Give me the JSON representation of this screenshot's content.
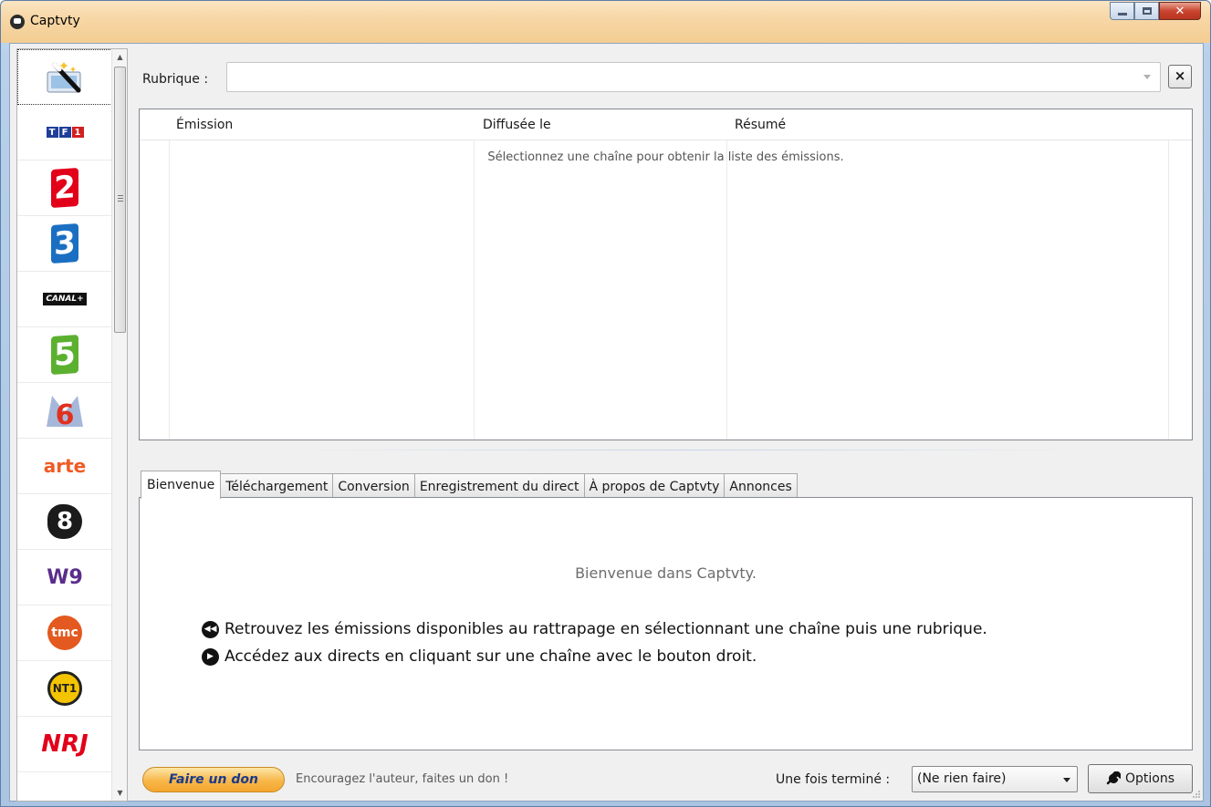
{
  "window": {
    "title": "Captvty",
    "controls": [
      "minimize",
      "maximize",
      "close"
    ]
  },
  "sidebar": {
    "channels": [
      {
        "name": "magic-wand",
        "label": ""
      },
      {
        "name": "tf1",
        "label": "TF1"
      },
      {
        "name": "france2",
        "label": "2"
      },
      {
        "name": "france3",
        "label": "3"
      },
      {
        "name": "canalplus",
        "label": "CANAL+"
      },
      {
        "name": "france5",
        "label": "5"
      },
      {
        "name": "m6",
        "label": "6"
      },
      {
        "name": "arte",
        "label": "arte"
      },
      {
        "name": "c8",
        "label": "8"
      },
      {
        "name": "w9",
        "label": "W9"
      },
      {
        "name": "tmc",
        "label": "tmc"
      },
      {
        "name": "nt1",
        "label": "NT1"
      },
      {
        "name": "nrj12",
        "label": "NRJ"
      }
    ]
  },
  "rubrique": {
    "label": "Rubrique :",
    "value": "",
    "clear_label": "×"
  },
  "grid": {
    "columns": [
      "Émission",
      "Diffusée le",
      "Résumé"
    ],
    "empty_message": "Sélectionnez une chaîne pour obtenir la liste des émissions."
  },
  "tabs": [
    {
      "label": "Bienvenue",
      "active": true
    },
    {
      "label": "Téléchargement",
      "active": false
    },
    {
      "label": "Conversion",
      "active": false
    },
    {
      "label": "Enregistrement du direct",
      "active": false
    },
    {
      "label": "À propos de Captvty",
      "active": false
    },
    {
      "label": "Annonces",
      "active": false
    }
  ],
  "welcome": {
    "title": "Bienvenue dans Captvty.",
    "tip1": "Retrouvez les émissions disponibles au rattrapage en sélectionnant une chaîne puis une rubrique.",
    "tip2": "Accédez aux directs en cliquant sur une chaîne avec le bouton droit.",
    "tip1_icon": "rewind-icon",
    "tip2_icon": "play-icon"
  },
  "footer": {
    "donate_label": "Faire un don",
    "donate_text": "Encouragez l'auteur, faites un don !",
    "finish_label": "Une fois terminé :",
    "finish_value": "(Ne rien faire)",
    "options_label": "Options"
  },
  "colors": {
    "title_bar": "#f7d7a6",
    "donate_button": "#f7b749",
    "link_blue": "#1b3a8a"
  }
}
